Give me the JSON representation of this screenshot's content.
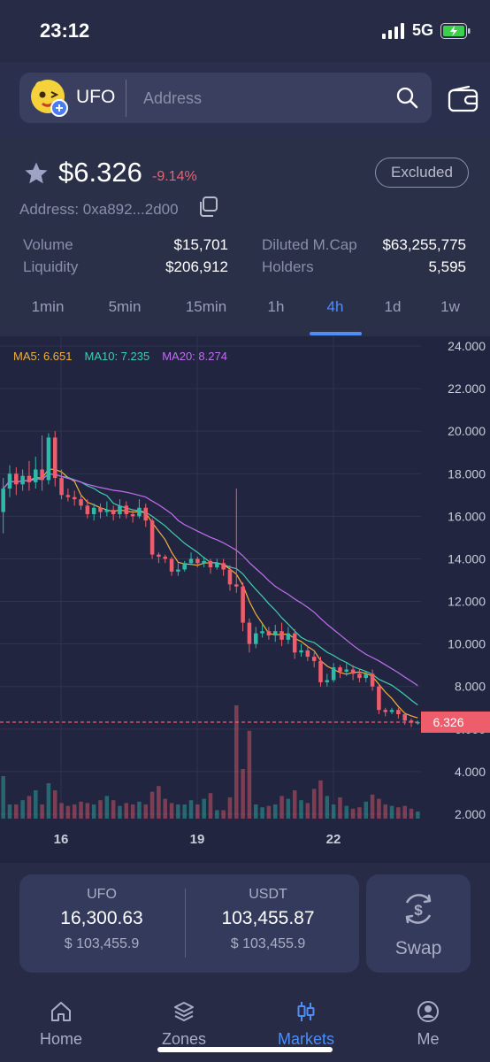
{
  "status": {
    "time": "23:12",
    "network": "5G"
  },
  "search": {
    "token": "UFO",
    "placeholder": "Address"
  },
  "token": {
    "price": "$6.326",
    "change": "-9.14%",
    "badge": "Excluded",
    "address": "Address: 0xa892...2d00"
  },
  "stats": {
    "volume_label": "Volume",
    "volume": "$15,701",
    "liquidity_label": "Liquidity",
    "liquidity": "$206,912",
    "mcap_label": "Diluted M.Cap",
    "mcap": "$63,255,775",
    "holders_label": "Holders",
    "holders": "5,595"
  },
  "timeframes": [
    "1min",
    "5min",
    "15min",
    "1h",
    "4h",
    "1d",
    "1w"
  ],
  "active_timeframe": "4h",
  "chart": {
    "ma5": "MA5: 6.651",
    "ma10": "MA10: 7.235",
    "ma20": "MA20: 8.274",
    "current_price_label": "6.326",
    "y_ticks": [
      "24.000",
      "22.000",
      "20.000",
      "18.000",
      "16.000",
      "14.000",
      "12.000",
      "10.000",
      "8.000",
      "6.000",
      "4.000",
      "2.000"
    ],
    "x_ticks": [
      "16",
      "19",
      "22"
    ]
  },
  "chart_data": {
    "type": "candlestick",
    "ylim": [
      2,
      24
    ],
    "current_price": 6.326,
    "ma_legend": {
      "MA5": 6.651,
      "MA10": 7.235,
      "MA20": 8.274
    },
    "x_labels": [
      "16",
      "19",
      "22"
    ],
    "colors": {
      "up": "#2fb9a8",
      "down": "#ee5d6c",
      "ma5": "#f0b23c",
      "ma10": "#3fcfad",
      "ma20": "#c26ef0"
    },
    "candles": [
      [
        16.2,
        17.3,
        17.8,
        15.2
      ],
      [
        17.3,
        18.0,
        18.4,
        16.9
      ],
      [
        18.0,
        17.5,
        18.3,
        17.0
      ],
      [
        17.5,
        17.9,
        18.2,
        17.2
      ],
      [
        17.9,
        17.6,
        18.6,
        17.2
      ],
      [
        17.6,
        18.2,
        18.8,
        17.3
      ],
      [
        18.2,
        17.7,
        19.8,
        17.2
      ],
      [
        17.7,
        19.7,
        19.9,
        17.5
      ],
      [
        19.7,
        17.8,
        20.0,
        17.4
      ],
      [
        17.8,
        17.0,
        18.2,
        16.8
      ],
      [
        17.0,
        16.9,
        17.3,
        16.7
      ],
      [
        16.9,
        16.8,
        17.2,
        16.5
      ],
      [
        16.8,
        16.5,
        17.0,
        16.3
      ],
      [
        16.5,
        16.1,
        16.8,
        15.9
      ],
      [
        16.1,
        16.4,
        16.6,
        15.8
      ],
      [
        16.4,
        16.2,
        16.6,
        15.9
      ],
      [
        16.2,
        16.3,
        16.7,
        16.0
      ],
      [
        16.3,
        16.1,
        16.5,
        15.8
      ],
      [
        16.1,
        16.5,
        16.8,
        15.9
      ],
      [
        16.5,
        16.1,
        16.7,
        15.9
      ],
      [
        16.1,
        16.0,
        16.3,
        15.7
      ],
      [
        16.0,
        16.4,
        16.8,
        15.9
      ],
      [
        16.4,
        15.8,
        16.6,
        15.5
      ],
      [
        15.8,
        14.2,
        15.9,
        14.0
      ],
      [
        14.2,
        14.1,
        14.3,
        13.8
      ],
      [
        14.1,
        14.0,
        14.2,
        13.8
      ],
      [
        14.0,
        13.4,
        14.1,
        13.2
      ],
      [
        13.4,
        13.5,
        13.8,
        13.2
      ],
      [
        13.5,
        13.8,
        13.9,
        13.4
      ],
      [
        13.8,
        14.0,
        14.3,
        13.7
      ],
      [
        14.0,
        13.8,
        14.1,
        13.6
      ],
      [
        13.8,
        13.9,
        14.1,
        13.6
      ],
      [
        13.9,
        13.6,
        14.0,
        13.3
      ],
      [
        13.6,
        13.8,
        14.0,
        13.5
      ],
      [
        13.8,
        13.5,
        14.0,
        13.2
      ],
      [
        13.5,
        12.8,
        13.7,
        12.5
      ],
      [
        12.8,
        12.7,
        17.3,
        12.4
      ],
      [
        12.7,
        11.0,
        12.9,
        10.6
      ],
      [
        11.0,
        10.0,
        11.2,
        9.6
      ],
      [
        10.0,
        10.5,
        10.8,
        9.8
      ],
      [
        10.5,
        10.6,
        10.9,
        10.3
      ],
      [
        10.6,
        10.4,
        10.8,
        10.2
      ],
      [
        10.4,
        10.6,
        10.9,
        10.1
      ],
      [
        10.6,
        10.2,
        11.0,
        9.9
      ],
      [
        10.2,
        10.5,
        10.8,
        10.0
      ],
      [
        10.5,
        9.6,
        10.7,
        9.3
      ],
      [
        9.6,
        9.7,
        10.0,
        9.4
      ],
      [
        9.7,
        9.4,
        9.9,
        9.2
      ],
      [
        9.4,
        9.2,
        9.6,
        8.9
      ],
      [
        9.2,
        8.2,
        9.4,
        8.0
      ],
      [
        8.2,
        8.3,
        8.6,
        8.0
      ],
      [
        8.3,
        8.9,
        9.1,
        8.2
      ],
      [
        8.9,
        8.7,
        9.0,
        8.4
      ],
      [
        8.7,
        8.8,
        9.1,
        8.5
      ],
      [
        8.8,
        8.6,
        9.0,
        8.3
      ],
      [
        8.6,
        8.4,
        8.8,
        8.2
      ],
      [
        8.4,
        8.6,
        8.7,
        8.2
      ],
      [
        8.6,
        8.0,
        8.8,
        7.8
      ],
      [
        8.0,
        6.9,
        8.1,
        6.7
      ],
      [
        6.9,
        6.8,
        7.0,
        6.6
      ],
      [
        6.8,
        6.9,
        7.0,
        6.7
      ],
      [
        6.9,
        6.7,
        7.0,
        6.5
      ],
      [
        6.7,
        6.4,
        6.8,
        6.2
      ],
      [
        6.4,
        6.3,
        6.5,
        6.1
      ],
      [
        6.3,
        6.33,
        6.4,
        6.2
      ]
    ],
    "volume_heights": [
      3.0,
      1.0,
      1.0,
      1.3,
      1.6,
      2.0,
      1.0,
      2.5,
      2.0,
      1.1,
      0.9,
      1.0,
      1.2,
      1.1,
      1.0,
      1.3,
      1.6,
      1.3,
      0.9,
      1.1,
      1.0,
      1.2,
      1.0,
      1.9,
      2.3,
      1.4,
      1.1,
      1.0,
      1.0,
      1.3,
      1.0,
      1.4,
      1.8,
      0.6,
      0.6,
      1.5,
      8.0,
      3.5,
      6.2,
      1.0,
      0.8,
      0.9,
      1.0,
      1.6,
      1.4,
      2.0,
      1.3,
      1.1,
      2.1,
      2.7,
      1.6,
      1.0,
      1.5,
      0.9,
      0.7,
      0.8,
      1.2,
      1.7,
      1.4,
      1.0,
      0.9,
      0.8,
      0.9,
      0.7,
      0.5
    ]
  },
  "balances": [
    {
      "symbol": "UFO",
      "amount": "16,300.63",
      "usd": "$ 103,455.9"
    },
    {
      "symbol": "USDT",
      "amount": "103,455.87",
      "usd": "$ 103,455.9"
    }
  ],
  "swap_label": "Swap",
  "nav": [
    {
      "label": "Home",
      "icon": "home-icon"
    },
    {
      "label": "Zones",
      "icon": "layers-icon"
    },
    {
      "label": "Markets",
      "icon": "candles-icon"
    },
    {
      "label": "Me",
      "icon": "person-icon"
    }
  ],
  "active_nav": "Markets"
}
